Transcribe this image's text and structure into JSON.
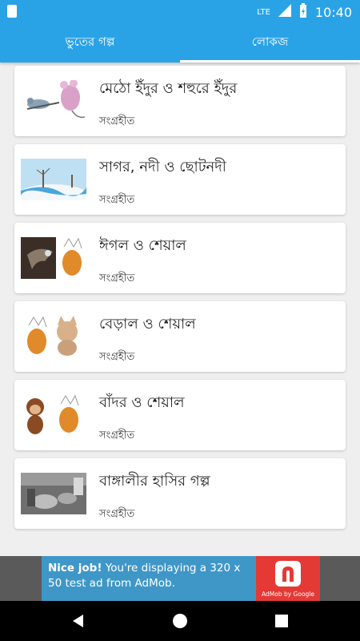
{
  "status_bar": {
    "network": "LTE",
    "time": "10:40"
  },
  "tabs": [
    {
      "label": "ভুতের গল্প",
      "active": false
    },
    {
      "label": "লোকজ",
      "active": true
    }
  ],
  "stories": [
    {
      "title": "মেঠো ইঁদুর ও শহুরে ইঁদুর",
      "author": "সংগ্রহীত",
      "thumb": "mouse-thumbnail"
    },
    {
      "title": "সাগর, নদী ও ছোটনদী",
      "author": "সংগ্রহীত",
      "thumb": "snow-river-thumbnail"
    },
    {
      "title": "ঈগল ও শেয়াল",
      "author": "সংগ্রহীত",
      "thumb": "eagle-fox-thumbnail"
    },
    {
      "title": "বেড়াল ও শেয়াল",
      "author": "সংগ্রহীত",
      "thumb": "cat-fox-thumbnail"
    },
    {
      "title": "বাঁদর ও শেয়াল",
      "author": "সংগ্রহীত",
      "thumb": "monkey-fox-thumbnail"
    },
    {
      "title": "বাঙ্গালীর হাসির গল্প",
      "author": "সংগ্রহীত",
      "thumb": "photo-thumbnail"
    }
  ],
  "ad": {
    "headline": "Nice job!",
    "body": " You're displaying a 320 x 50 test ad from AdMob.",
    "badge": "AdMob by Google"
  },
  "colors": {
    "primary": "#2aa3e6",
    "ad_bg": "#3f97c8",
    "ad_badge": "#e53935"
  }
}
